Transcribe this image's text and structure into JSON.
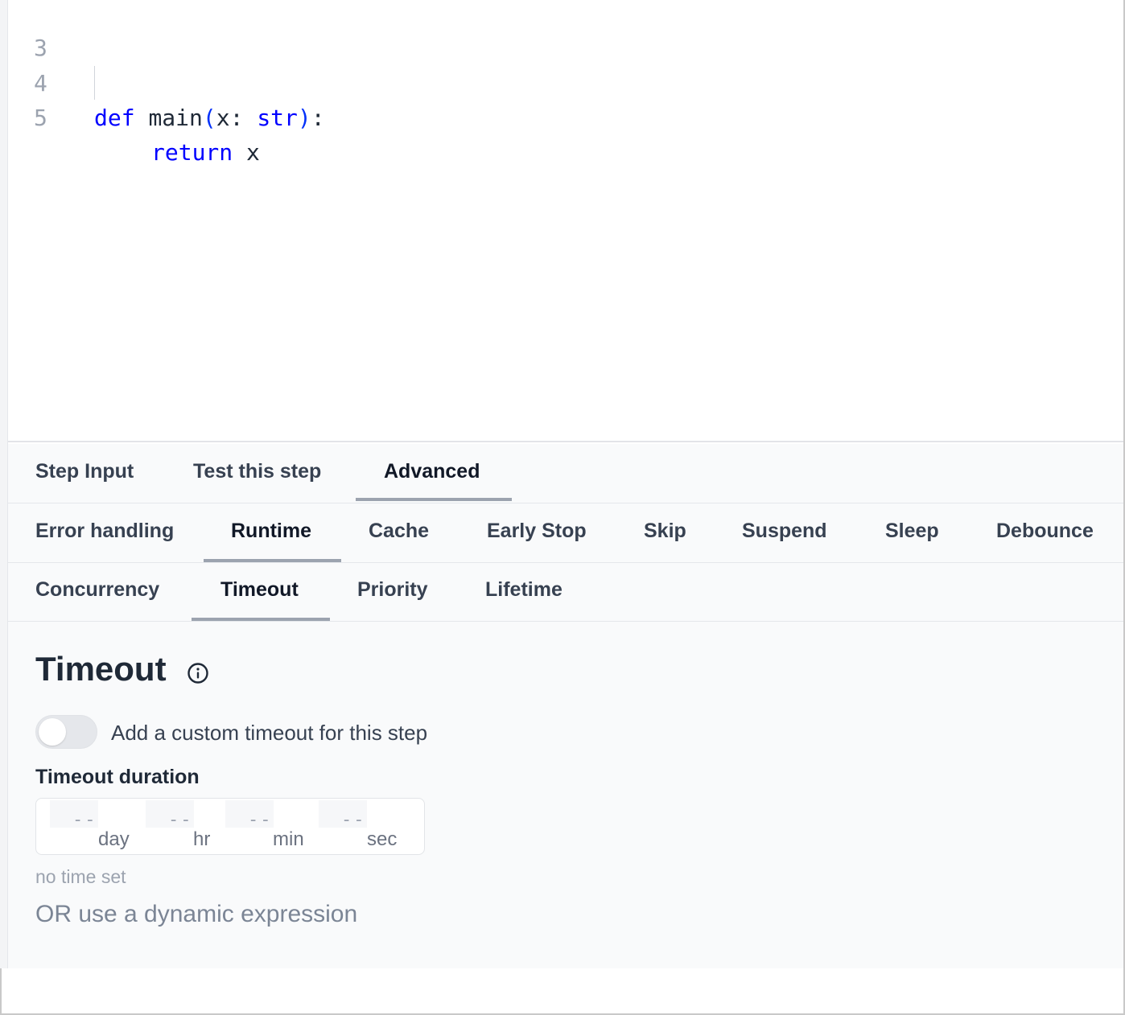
{
  "editor": {
    "lines": [
      {
        "number": "3",
        "code": ""
      },
      {
        "number": "4",
        "keyword": "def",
        "name": "main",
        "open_paren": "(",
        "param": "x:",
        "type": "str",
        "close_paren": ")",
        "colon": ":"
      },
      {
        "number": "5",
        "keyword": "return",
        "value": "x"
      }
    ]
  },
  "tabs": {
    "primary": [
      "Step Input",
      "Test this step",
      "Advanced"
    ],
    "primary_active": "Advanced",
    "advanced_row1": [
      "Error handling",
      "Runtime",
      "Cache",
      "Early Stop",
      "Skip",
      "Suspend",
      "Sleep",
      "Debounce"
    ],
    "advanced_row2": [
      "Concurrency",
      "Timeout",
      "Priority",
      "Lifetime"
    ],
    "active_row1": "Runtime",
    "active_row2": "Timeout"
  },
  "timeout": {
    "title": "Timeout",
    "toggle_label": "Add a custom timeout for this step",
    "toggle_on": false,
    "duration_label": "Timeout duration",
    "fields": [
      {
        "placeholder": "--",
        "unit": "day"
      },
      {
        "placeholder": "--",
        "unit": "hr"
      },
      {
        "placeholder": "--",
        "unit": "min"
      },
      {
        "placeholder": "--",
        "unit": "sec"
      }
    ],
    "status": "no time set",
    "dynamic_link": "OR use a dynamic expression"
  },
  "colors": {
    "keyword": "#0000ff",
    "paren": "#0431fa",
    "active_underline": "#9ca3af",
    "panel_bg": "#f9fafb"
  },
  "icons": [
    "info-icon"
  ]
}
